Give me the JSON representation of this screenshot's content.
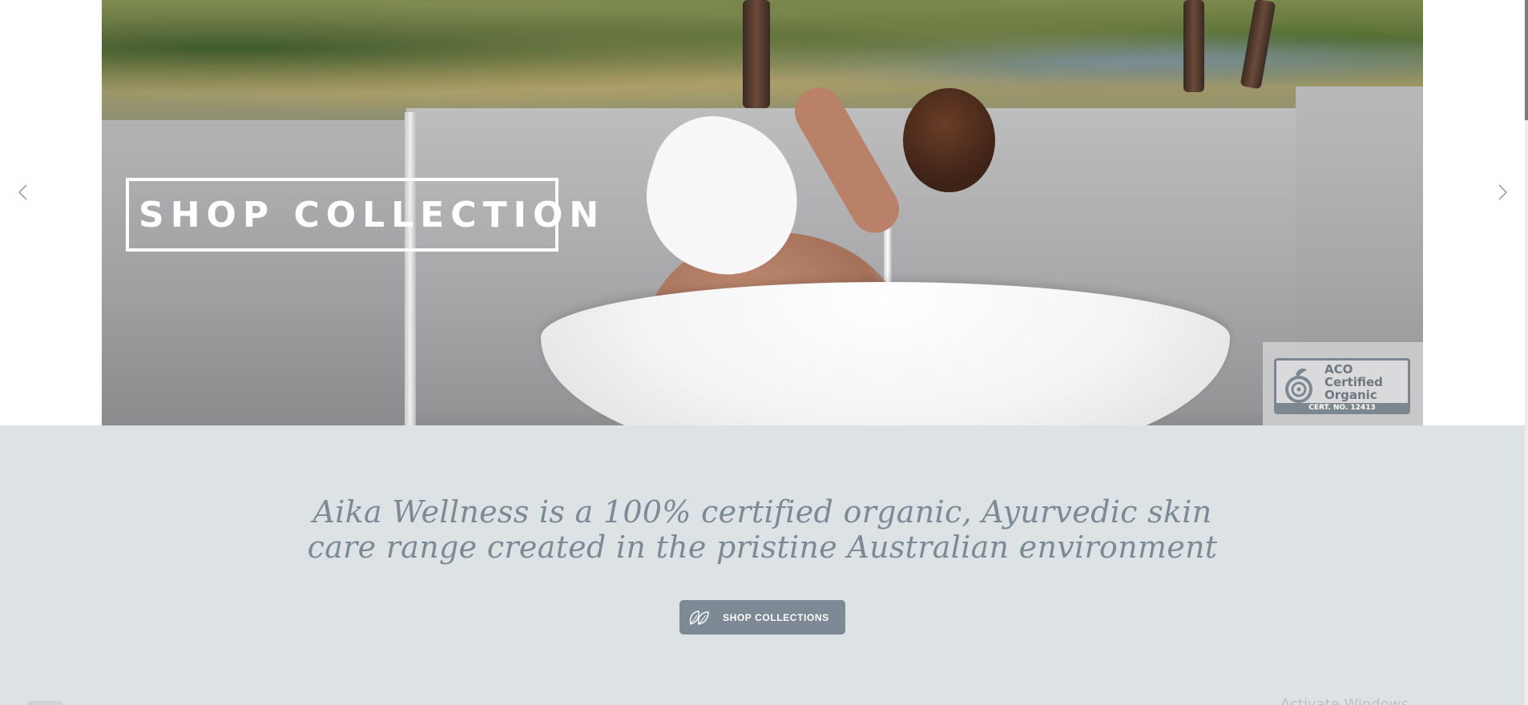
{
  "hero": {
    "headline": "SHOP COLLECTION",
    "prev_arrow_icon": "chevron-left-icon",
    "next_arrow_icon": "chevron-right-icon",
    "certification": {
      "line1": "ACO",
      "line2": "Certified",
      "line3": "Organic",
      "number": "CERT. NO. 12413"
    }
  },
  "intro": {
    "tagline_line1": "Aika Wellness is a 100% certified organic, Ayurvedic skin",
    "tagline_line2": "care range created in the pristine Australian environment",
    "cta_label": "SHOP COLLECTIONS",
    "cta_icon": "leaf-icon"
  },
  "os_overlay": {
    "watermark": "Activate Windows"
  },
  "colors": {
    "section_bg": "#dde2e5",
    "accent": "#7d8a95",
    "tagline": "#7c8a96"
  }
}
